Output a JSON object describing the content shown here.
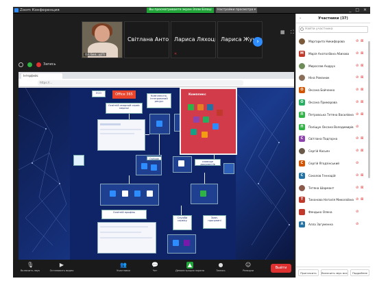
{
  "window": {
    "title": "Zoom Конференция",
    "sharing_banner": "Вы просматриваете экран Элли Білоці",
    "view_options": "Настройки просмотра ▾",
    "controls": "_ □ ✕"
  },
  "thumbnails": {
    "video_caption": "Ол. Бел...ці(?)",
    "names": [
      "Світлана Анто...",
      "Лариса Ляхоць...",
      "Лариса Жученко"
    ],
    "next_label": "›",
    "view_icons": "▦ ⛶"
  },
  "status": {
    "record_label": "Запись"
  },
  "browser": {
    "tab_label": "Інтерфейс",
    "url": "https://..."
  },
  "slide": {
    "badge_left": "ЕСО",
    "office_label": "Office 365",
    "center_top": "Освітній хмарний сервіс мережі",
    "center_mid": "Комплексно-інтегрований ресурс",
    "right_label": "Комплекс",
    "info_label": "Чатбот",
    "outlook_label": "Outlook",
    "storage_label": "сховище документів",
    "profile_label": "Освітній профіль",
    "bottom_left": "Освітній профіль користувача",
    "bottom_mid": "Служби сервісу",
    "bottom_right": "Зовн. програмні"
  },
  "participants": {
    "title": "Участники (37)",
    "search_placeholder": "Найти участника",
    "items": [
      {
        "initial": "",
        "name": "Маргарита Никифорова",
        "color": "#7a5a3a",
        "cam_off": true,
        "photo": true
      },
      {
        "initial": "М",
        "name": "Марія Анатоліївна Абизова",
        "color": "#c0392b",
        "cam_off": true,
        "photo": false
      },
      {
        "initial": "",
        "name": "Мирослав Андрух",
        "color": "#6e8c5a",
        "cam_off": true,
        "photo": true
      },
      {
        "initial": "",
        "name": "Ніна Романюк",
        "color": "#8a6e5a",
        "cam_off": true,
        "photo": true
      },
      {
        "initial": "О",
        "name": "Оксана Бойченко",
        "color": "#d35400",
        "cam_off": true,
        "photo": false
      },
      {
        "initial": "О",
        "name": "Оксана Примарова",
        "color": "#27ae60",
        "cam_off": true,
        "photo": false
      },
      {
        "initial": "П",
        "name": "Петровська Тетяна Василівна",
        "color": "#2fb344",
        "cam_off": true,
        "photo": false
      },
      {
        "initial": "П",
        "name": "Поліщук Оксана Володимирівна",
        "color": "#2fb344",
        "cam_off": false,
        "photo": false
      },
      {
        "initial": "С",
        "name": "Світлана Подгорна",
        "color": "#8e44ad",
        "cam_off": true,
        "photo": false
      },
      {
        "initial": "",
        "name": "Сергій Касьян",
        "color": "#6a5a4a",
        "cam_off": true,
        "photo": true
      },
      {
        "initial": "С",
        "name": "Сергій Ягодзінський",
        "color": "#d35400",
        "cam_off": false,
        "photo": false
      },
      {
        "initial": "С",
        "name": "Соколов Геннадій",
        "color": "#2471a3",
        "cam_off": true,
        "photo": false
      },
      {
        "initial": "",
        "name": "Тетяна Шармант",
        "color": "#8a5a4a",
        "cam_off": true,
        "photo": true
      },
      {
        "initial": "Т",
        "name": "Тихонова Наталія Миколаївна",
        "color": "#c0392b",
        "cam_off": true,
        "photo": false
      },
      {
        "initial": "",
        "name": "Фендько Олена",
        "color": "#c0392b",
        "cam_off": false,
        "photo": false
      },
      {
        "initial": "А",
        "name": "Алла Загуменна",
        "color": "#2471a3",
        "cam_off": false,
        "photo": false
      }
    ],
    "footer": {
      "invite": "Пригласить",
      "mute_all": "Включить звук всех",
      "more": "Подробнее"
    }
  },
  "toolbar": {
    "audio": "Включить звук",
    "video": "Остановить видео",
    "participants": "Участники",
    "participants_count": "37",
    "chat": "Чат",
    "share": "Демонстрация экрана",
    "record": "Запись",
    "reactions": "Реакции",
    "leave": "Выйти"
  },
  "colors": {
    "accent_blue": "#2d8cff",
    "share_green": "#23a43b",
    "danger_red": "#e03131"
  }
}
